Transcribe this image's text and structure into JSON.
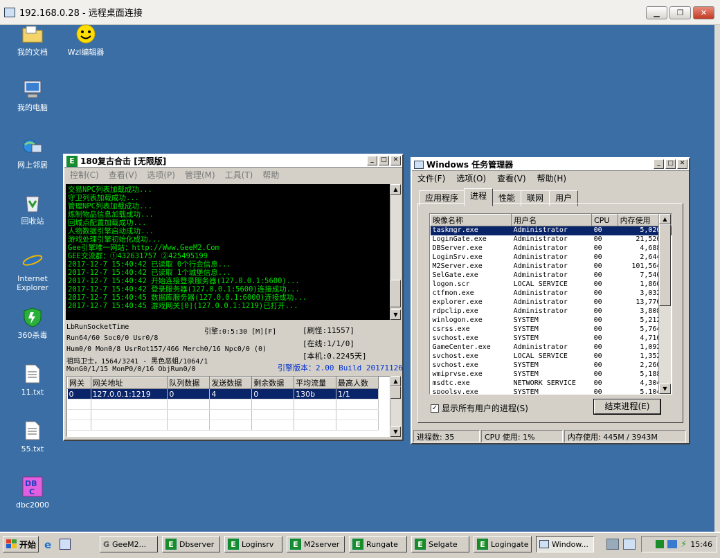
{
  "remote_window": {
    "title": "192.168.0.28 - 远程桌面连接"
  },
  "desktop_icons": [
    {
      "label": "我的文档",
      "icon": "documents-folder-icon"
    },
    {
      "label": "Wzl编辑器",
      "icon": "smiley-icon"
    },
    {
      "label": "我的电脑",
      "icon": "computer-icon"
    },
    {
      "label": "网上邻居",
      "icon": "network-icon"
    },
    {
      "label": "回收站",
      "icon": "recycle-bin-icon"
    },
    {
      "label": "Internet Explorer",
      "icon": "ie-icon"
    },
    {
      "label": "360杀毒",
      "icon": "shield-icon"
    },
    {
      "label": "11.txt",
      "icon": "text-file-icon"
    },
    {
      "label": "55.txt",
      "icon": "text-file-icon"
    },
    {
      "label": "dbc2000",
      "icon": "dbc-icon"
    }
  ],
  "engine": {
    "title": "180复古合击 [无限版]",
    "menu": [
      "控制(C)",
      "查看(V)",
      "选项(P)",
      "管理(M)",
      "工具(T)",
      "帮助"
    ],
    "log": [
      "交易NPC列表加载成功...",
      "守卫列表加载成功...",
      "管理NPC列表加载成功...",
      "炼制物品信息加载成功...",
      "回城点配置加载成功...",
      "人物数据引擎启动成功...",
      "游戏处理引擎初始化成功...",
      "Gee引擎唯一网站：http://Www.GeeM2.Com",
      "GEE交流群：①432631757    ②425495199",
      "2017-12-7 15:40:42 已读取 0个行会信息...",
      "2017-12-7 15:40:42 已读取 1个城堡信息...",
      "2017-12-7 15:40:42 开始连接登录服务器(127.0.0.1:5600)...",
      "2017-12-7 15:40:42 登录服务器(127.0.0.1:5600)连接成功...",
      "2017-12-7 15:40:45 数据库服务器(127.0.0.1:6000)连接成功...",
      "2017-12-7 15:40:45 游戏网关[0](127.0.0.1:1219)已打开..."
    ],
    "stats": {
      "socket": "LbRunSocketTime",
      "run": "Run64/60 Soc0/0 Usr0/8",
      "hum": "Hum0/0 Mon0/8 UsrRot157/466 Merch0/16 Npc0/0 (0)",
      "guard": "祖玛卫士，1564/3241 - 黑色恶蛆/1064/1",
      "mon": "MonG0/1/15 MonP0/0/16 ObjRun0/0",
      "engine_time": "引擎:0:5:30 [M][F]",
      "refresh": "[刷怪:11557]",
      "online": "[在线:1/1/0]",
      "local": "[本机:0.2245天]",
      "version": "引擎版本：2.00 Build 20171126"
    },
    "gate_columns": [
      "网关",
      "网关地址",
      "队列数据",
      "发送数据",
      "剩余数据",
      "平均流量",
      "最高人数"
    ],
    "gate_rows": [
      [
        "0",
        "127.0.0.1:1219",
        "0",
        "4",
        "0",
        "130b",
        "1/1"
      ]
    ]
  },
  "taskmgr": {
    "title": "Windows 任务管理器",
    "menu": [
      "文件(F)",
      "选项(O)",
      "查看(V)",
      "帮助(H)"
    ],
    "tabs": [
      "应用程序",
      "进程",
      "性能",
      "联网",
      "用户"
    ],
    "active_tab": "进程",
    "columns": [
      "映像名称",
      "用户名",
      "CPU",
      "内存使用"
    ],
    "processes": [
      [
        "taskmgr.exe",
        "Administrator",
        "00",
        "5,020 K"
      ],
      [
        "LoginGate.exe",
        "Administrator",
        "00",
        "21,520 K"
      ],
      [
        "DBServer.exe",
        "Administrator",
        "00",
        "4,688 K"
      ],
      [
        "LoginSrv.exe",
        "Administrator",
        "00",
        "2,644 K"
      ],
      [
        "M2Server.exe",
        "Administrator",
        "00",
        "101,564 K"
      ],
      [
        "SelGate.exe",
        "Administrator",
        "00",
        "7,540 K"
      ],
      [
        "logon.scr",
        "LOCAL SERVICE",
        "00",
        "1,860 K"
      ],
      [
        "ctfmon.exe",
        "Administrator",
        "00",
        "3,032 K"
      ],
      [
        "explorer.exe",
        "Administrator",
        "00",
        "13,776 K"
      ],
      [
        "rdpclip.exe",
        "Administrator",
        "00",
        "3,808 K"
      ],
      [
        "winlogon.exe",
        "SYSTEM",
        "00",
        "5,212 K"
      ],
      [
        "csrss.exe",
        "SYSTEM",
        "00",
        "5,764 K"
      ],
      [
        "svchost.exe",
        "SYSTEM",
        "00",
        "4,716 K"
      ],
      [
        "GameCenter.exe",
        "Administrator",
        "00",
        "1,092 K"
      ],
      [
        "svchost.exe",
        "LOCAL SERVICE",
        "00",
        "1,352 K"
      ],
      [
        "svchost.exe",
        "SYSTEM",
        "00",
        "2,260 K"
      ],
      [
        "wmiprvse.exe",
        "SYSTEM",
        "00",
        "5,188 K"
      ],
      [
        "msdtc.exe",
        "NETWORK SERVICE",
        "00",
        "4,304 K"
      ],
      [
        "spoolsv.exe",
        "SYSTEM",
        "00",
        "5,104 K"
      ]
    ],
    "show_all_label": "显示所有用户的进程(S)",
    "end_process_label": "结束进程(E)",
    "status": {
      "processes": "进程数: 35",
      "cpu": "CPU 使用: 1%",
      "memory": "内存使用: 445M / 3943M"
    }
  },
  "taskbar": {
    "start": "开始",
    "tasks": [
      "GeeM2...",
      "Dbserver",
      "Loginsrv",
      "M2server",
      "Rungate",
      "Selgate",
      "Logingate",
      "Window..."
    ],
    "clock": "15:46"
  }
}
